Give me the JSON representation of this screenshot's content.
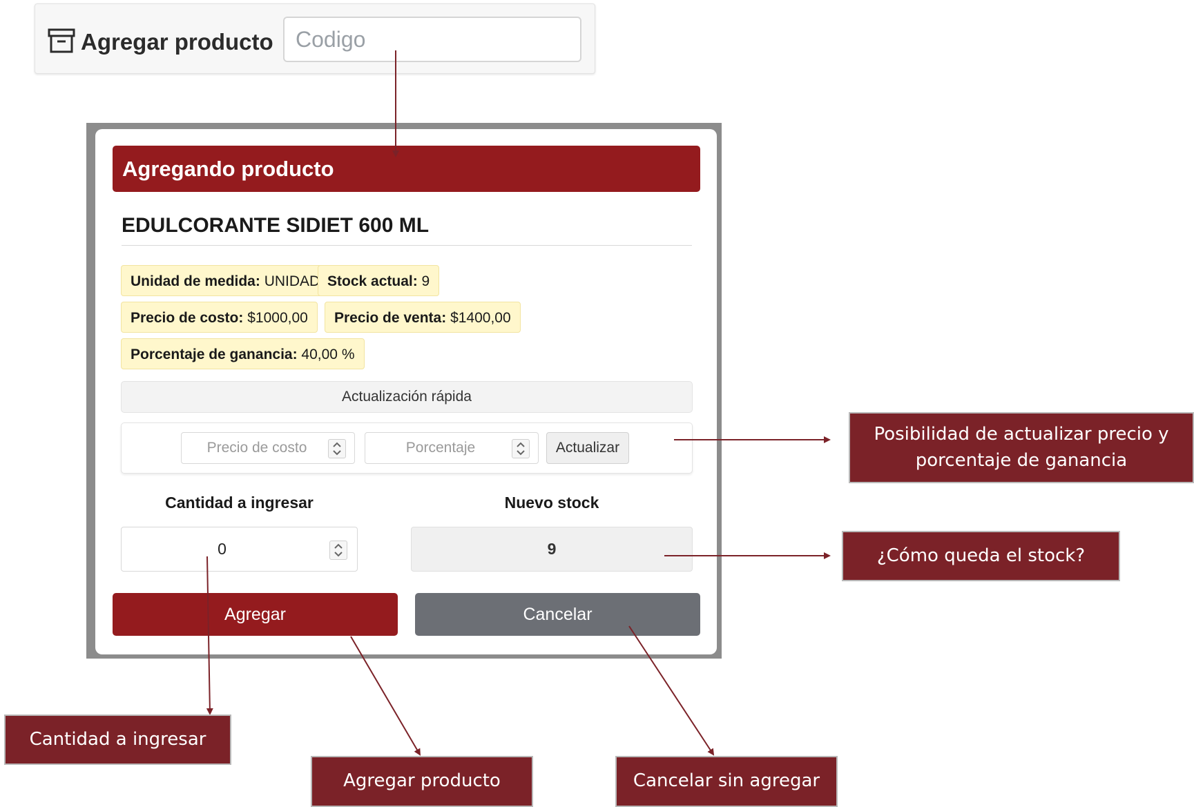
{
  "search_bar": {
    "title": "Agregar producto",
    "icon": "archive-box-icon",
    "code_placeholder": "Codigo"
  },
  "dialog": {
    "header": "Agregando producto",
    "product_name": "EDULCORANTE SIDIET 600 ML",
    "info": {
      "unidad_label": "Unidad de medida:",
      "unidad_value": " UNIDAD",
      "stock_label": "Stock actual:",
      "stock_value": " 9",
      "costo_label": "Precio de costo:",
      "costo_value": " $1000,00",
      "venta_label": "Precio de venta:",
      "venta_value": " $1400,00",
      "ganancia_label": "Porcentaje de ganancia:",
      "ganancia_value": " 40,00 %"
    },
    "quick_update": {
      "title": "Actualización rápida",
      "costo_placeholder": "Precio de costo",
      "porcentaje_placeholder": "Porcentaje",
      "button": "Actualizar"
    },
    "cantidad_label": "Cantidad a ingresar",
    "cantidad_value": "0",
    "nuevo_stock_label": "Nuevo stock",
    "nuevo_stock_value": "9",
    "agregar_button": "Agregar",
    "cancelar_button": "Cancelar"
  },
  "callouts": {
    "actualizar_line1": "Posibilidad de actualizar precio y",
    "actualizar_line2": "porcentaje de ganancia",
    "stock": "¿Cómo queda el stock?",
    "cantidad": "Cantidad a ingresar",
    "agregar": "Agregar producto",
    "cancelar": "Cancelar sin agregar"
  },
  "colors": {
    "brand_red": "#941b1e",
    "callout_bg": "#7b2228",
    "chip_bg": "#fff7cc",
    "cancel_gray": "#6c6f75"
  }
}
